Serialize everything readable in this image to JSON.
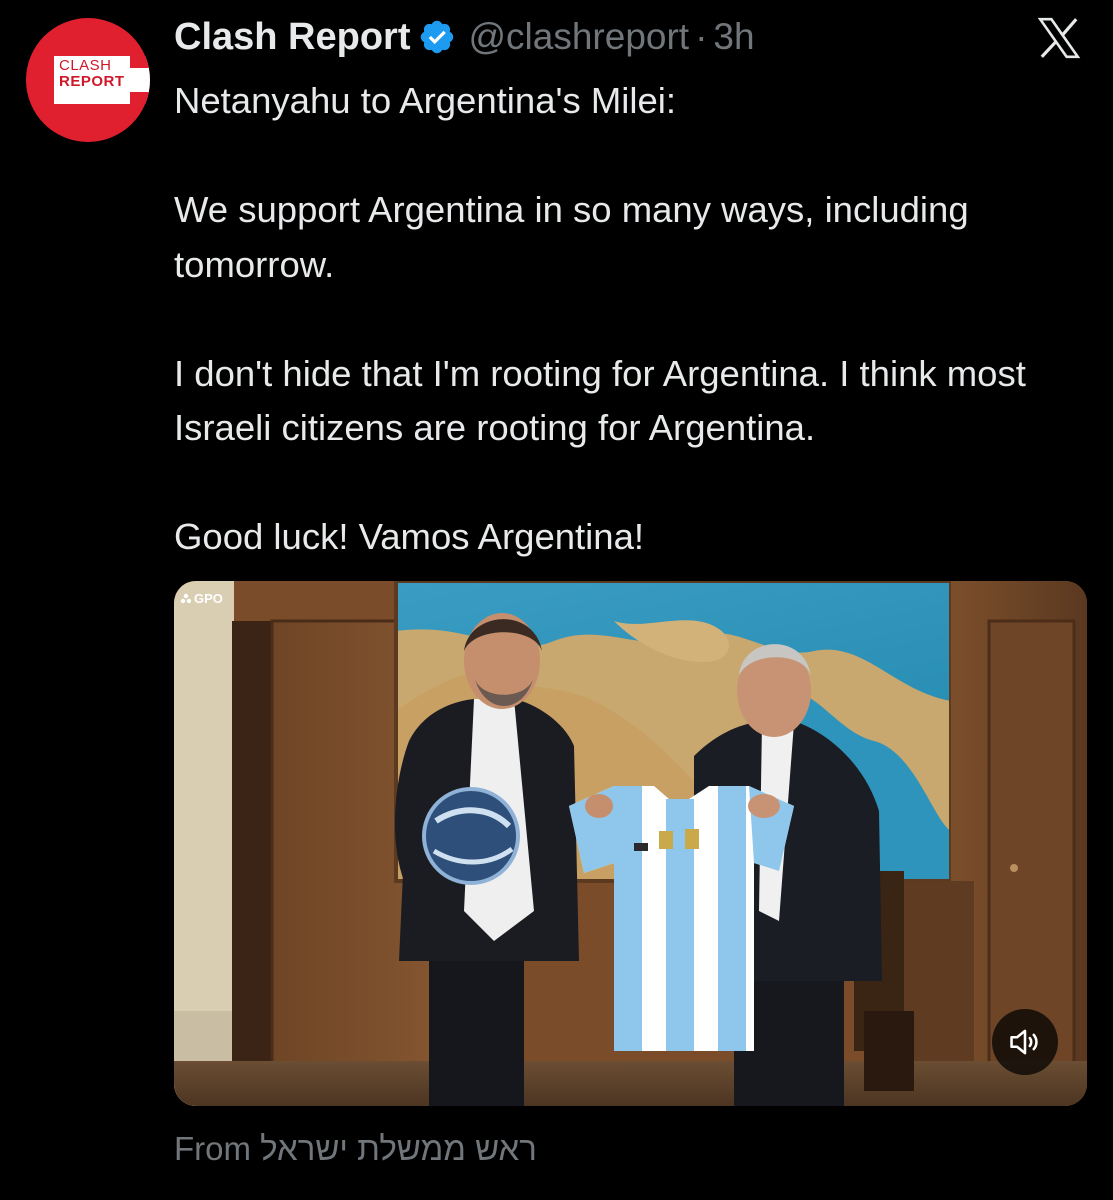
{
  "tweet": {
    "avatar_line1": "CLASH",
    "avatar_line2": "REPORT",
    "display_name": "Clash Report",
    "handle": "@clashreport",
    "separator": "·",
    "time": "3h",
    "paragraphs": [
      "Netanyahu to Argentina's Milei:",
      "We support Argentina in so many ways, including tomorrow.",
      "I don't hide that I'm rooting for Argentina. I think most Israeli citizens are rooting for Argentina.",
      "Good luck! Vamos Argentina!"
    ],
    "media": {
      "watermark": "GPO",
      "mute_icon": "speaker-muted-icon"
    },
    "from_label": "From",
    "from_source": "ראש ממשלת ישראל"
  },
  "colors": {
    "background": "#000000",
    "text_primary": "#e7e9ea",
    "text_secondary": "#71767b",
    "verified": "#1d9bf0",
    "avatar_red": "#e0202e"
  }
}
